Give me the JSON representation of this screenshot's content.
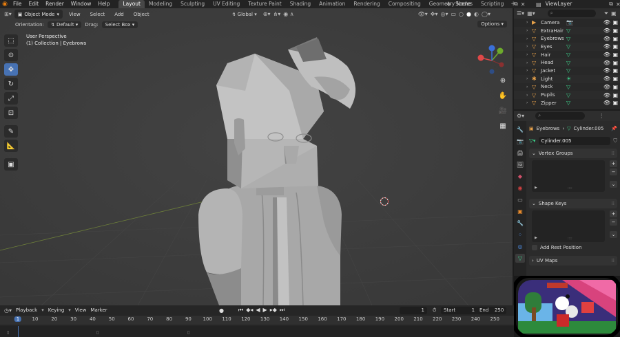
{
  "topbar": {
    "menus": [
      "File",
      "Edit",
      "Render",
      "Window",
      "Help"
    ],
    "workspaces": [
      "Layout",
      "Modeling",
      "Sculpting",
      "UV Editing",
      "Texture Paint",
      "Shading",
      "Animation",
      "Rendering",
      "Compositing",
      "Geometry Nodes",
      "Scripting"
    ],
    "active_workspace": "Layout",
    "scene": "Scene",
    "view_layer": "ViewLayer"
  },
  "viewport": {
    "mode": "Object Mode",
    "menus": [
      "View",
      "Select",
      "Add",
      "Object"
    ],
    "transform_orientation": "Global",
    "orientation_label": "Orientation:",
    "orientation_value": "Default",
    "drag_label": "Drag:",
    "drag_value": "Select Box",
    "options_label": "Options",
    "perspective": "User Perspective",
    "collection_info": "(1) Collection | Eyebrows",
    "accent_color": "#4772b3"
  },
  "outliner": {
    "search_placeholder": "",
    "items": [
      {
        "name": "Camera",
        "icon": "camera-icon"
      },
      {
        "name": "ExtraHair",
        "icon": "mesh-icon"
      },
      {
        "name": "Eyebrows",
        "icon": "mesh-icon"
      },
      {
        "name": "Eyes",
        "icon": "mesh-icon"
      },
      {
        "name": "Hair",
        "icon": "mesh-icon"
      },
      {
        "name": "Head",
        "icon": "mesh-icon"
      },
      {
        "name": "Jacket",
        "icon": "mesh-icon"
      },
      {
        "name": "Light",
        "icon": "light-icon"
      },
      {
        "name": "Neck",
        "icon": "mesh-icon"
      },
      {
        "name": "Pupils",
        "icon": "mesh-icon"
      },
      {
        "name": "Zipper",
        "icon": "mesh-icon"
      }
    ]
  },
  "properties": {
    "breadcrumb_object": "Eyebrows",
    "breadcrumb_data": "Cylinder.005",
    "mesh_name": "Cylinder.005",
    "panels": {
      "vertex_groups": "Vertex Groups",
      "shape_keys": "Shape Keys",
      "add_rest_position": "Add Rest Position",
      "uv_maps": "UV Maps"
    }
  },
  "timeline": {
    "menus": [
      "Playback",
      "Keying",
      "View",
      "Marker"
    ],
    "current_frame": "1",
    "start_label": "Start",
    "start": "1",
    "end_label": "End",
    "end": "250",
    "ruler": [
      "1",
      "10",
      "20",
      "30",
      "40",
      "50",
      "60",
      "70",
      "80",
      "90",
      "100",
      "110",
      "120",
      "130",
      "140",
      "150",
      "160",
      "170",
      "180",
      "190",
      "200",
      "210",
      "220",
      "230",
      "240",
      "250"
    ]
  }
}
